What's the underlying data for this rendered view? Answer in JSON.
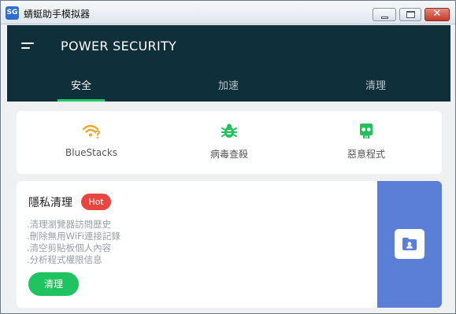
{
  "window": {
    "title": "蜻蜓助手模拟器",
    "app_icon_text": "SG",
    "close_glyph": "✕"
  },
  "header": {
    "title": "POWER SECURITY",
    "tabs": [
      {
        "label": "安全",
        "active": true
      },
      {
        "label": "加速",
        "active": false
      },
      {
        "label": "清理",
        "active": false
      }
    ]
  },
  "features": [
    {
      "label": "BlueStacks",
      "icon": "wifi-question-icon",
      "color": "#f2a52b"
    },
    {
      "label": "病毒查殺",
      "icon": "bug-icon",
      "color": "#22c15e"
    },
    {
      "label": "惡意程式",
      "icon": "skull-icon",
      "color": "#22c15e"
    }
  ],
  "privacy": {
    "title": "隱私清理",
    "badge": "Hot",
    "items": [
      ".清理瀏覽器訪問歷史",
      ".刪除無用WiFi連接記錄",
      ".清空剪貼板個人內容",
      ".分析程式權限信息"
    ],
    "button_label": "清理",
    "side_icon": "contact-folder-icon"
  },
  "colors": {
    "header_bg": "#0f2f3a",
    "accent_green": "#20c56a",
    "hot_red": "#e9463f",
    "panel_blue": "#5b7ed6"
  }
}
